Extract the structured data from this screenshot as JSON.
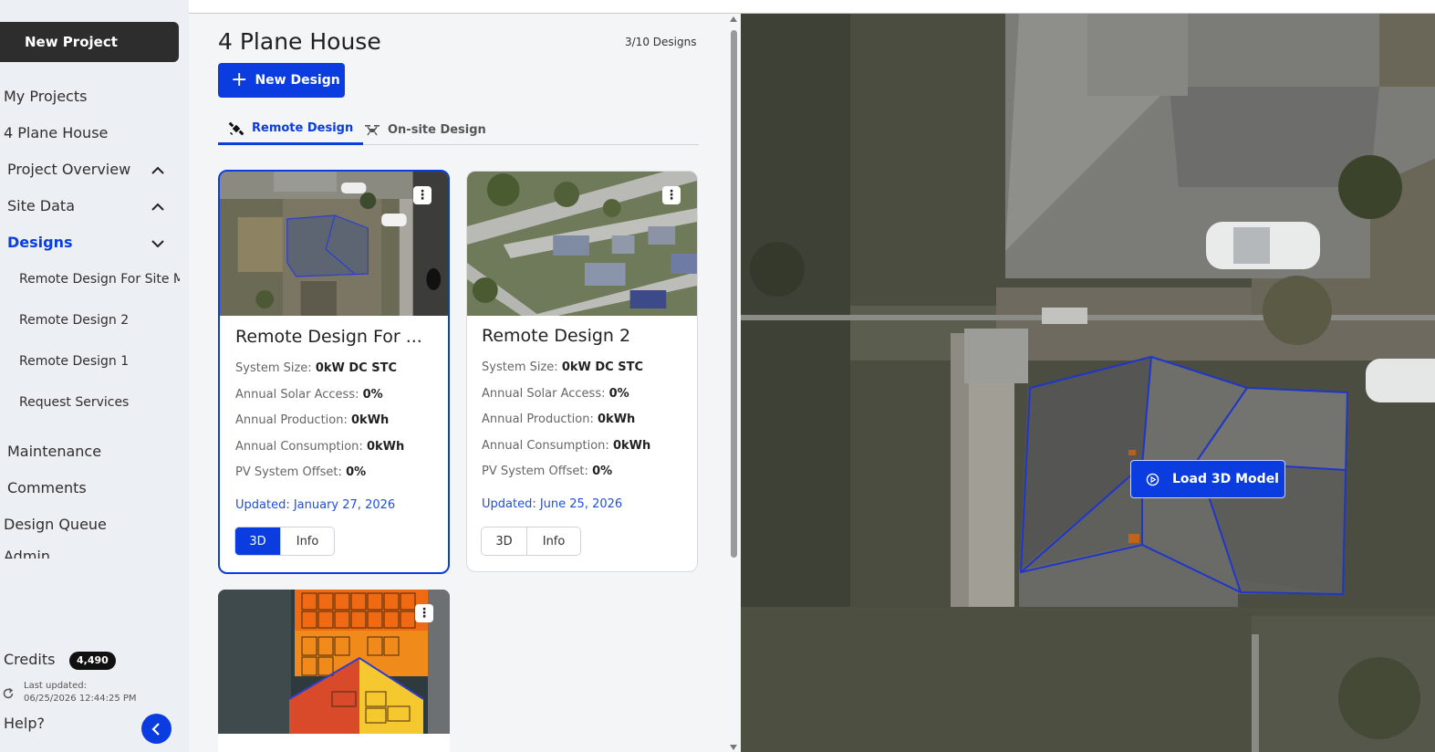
{
  "sidebar": {
    "new_project": "New Project",
    "my_projects": "My Projects",
    "project_name": "4 Plane House",
    "project_overview": "Project Overview",
    "site_data": "Site Data",
    "designs": "Designs",
    "design_items": [
      "Remote Design For Site M",
      "Remote Design 2",
      "Remote Design 1",
      "Request Services"
    ],
    "maintenance": "Maintenance",
    "comments": "Comments",
    "design_queue": "Design Queue",
    "admin_partial": "Admin",
    "credits_label": "Credits",
    "credits_value": "4,490",
    "last_updated_label": "Last updated:",
    "last_updated_value": "06/25/2026 12:44:25 PM",
    "help": "Help?"
  },
  "main": {
    "title": "4 Plane House",
    "design_count": "3/10 Designs",
    "new_design": "New Design",
    "tabs": [
      {
        "label": "Remote Design",
        "icon": "satellite-icon",
        "active": true
      },
      {
        "label": "On-site Design",
        "icon": "drone-icon",
        "active": false
      }
    ],
    "cards": [
      {
        "title": "Remote Design For ...",
        "system_size_label": "System Size:",
        "system_size": "0kW DC STC",
        "solar_access_label": "Annual Solar Access:",
        "solar_access": "0%",
        "production_label": "Annual Production:",
        "production": "0kWh",
        "consumption_label": "Annual Consumption:",
        "consumption": "0kWh",
        "offset_label": "PV System Offset:",
        "offset": "0%",
        "updated": "Updated: January 27, 2026",
        "btn_3d": "3D",
        "btn_info": "Info",
        "selected": true
      },
      {
        "title": "Remote Design 2",
        "system_size_label": "System Size:",
        "system_size": "0kW DC STC",
        "solar_access_label": "Annual Solar Access:",
        "solar_access": "0%",
        "production_label": "Annual Production:",
        "production": "0kWh",
        "consumption_label": "Annual Consumption:",
        "consumption": "0kWh",
        "offset_label": "PV System Offset:",
        "offset": "0%",
        "updated": "Updated: June 25, 2026",
        "btn_3d": "3D",
        "btn_info": "Info",
        "selected": false
      }
    ]
  },
  "map": {
    "load_3d": "Load 3D Model"
  },
  "colors": {
    "accent": "#0a3cdf",
    "sidebar_bg": "#eceff3",
    "panel_bg": "#f4f5f6"
  }
}
